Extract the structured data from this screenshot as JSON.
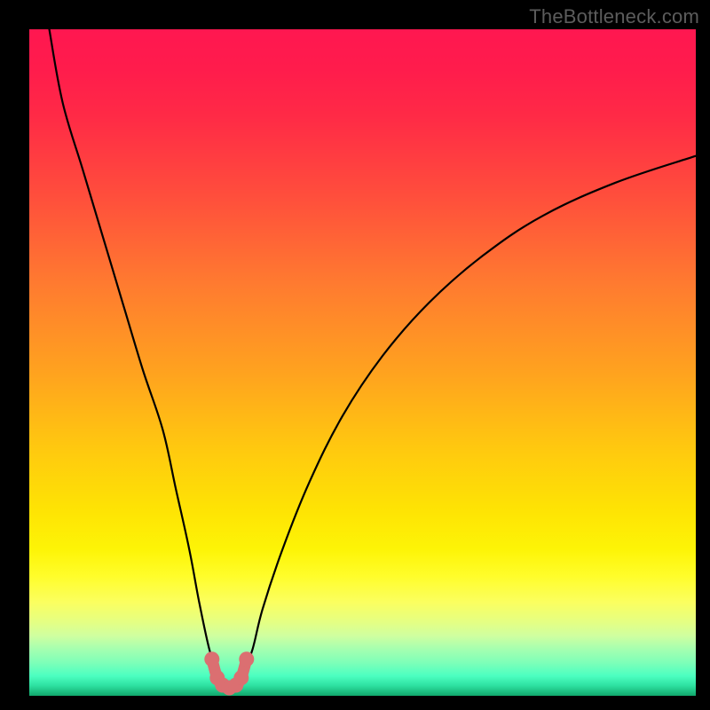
{
  "watermark": "TheBottleneck.com",
  "colors": {
    "page_bg": "#000000",
    "gradient_top": "#ff1750",
    "gradient_bottom": "#11a86c",
    "curve_stroke": "#000000",
    "marker_stroke": "#db6f71",
    "marker_fill": "#db6f71"
  },
  "chart_data": {
    "type": "line",
    "title": "",
    "xlabel": "",
    "ylabel": "",
    "xlim": [
      0,
      100
    ],
    "ylim": [
      0,
      100
    ],
    "grid": false,
    "legend": false,
    "series": [
      {
        "name": "bottleneck-curve",
        "x": [
          3,
          5,
          8,
          11,
          14,
          17,
          20,
          22,
          24,
          25.5,
          27,
          28.3,
          29,
          30,
          31,
          32,
          33.5,
          35,
          38,
          42,
          47,
          53,
          60,
          68,
          77,
          88,
          100
        ],
        "values": [
          100,
          89,
          79,
          69,
          59,
          49,
          40,
          31,
          22,
          14,
          7,
          3,
          1.5,
          1.2,
          1.5,
          3,
          7,
          13,
          22,
          32,
          42,
          51,
          59,
          66,
          72,
          77,
          81
        ]
      }
    ],
    "markers": {
      "name": "optimal-region",
      "x": [
        27.4,
        28.2,
        29.0,
        30.0,
        31.0,
        31.8,
        32.6
      ],
      "values": [
        5.5,
        2.7,
        1.6,
        1.2,
        1.6,
        2.7,
        5.5
      ]
    }
  }
}
